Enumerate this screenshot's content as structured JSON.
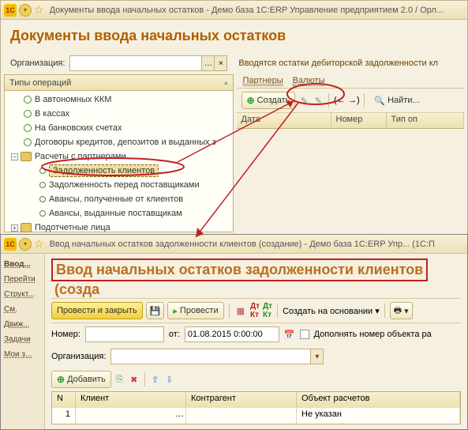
{
  "window1": {
    "title": "Документы ввода начальных остатков - Демо база 1С:ERP Управление предприятием 2.0 / Орл...",
    "page_title": "Документы ввода начальных остатков",
    "org_label": "Организация:",
    "filter_text": "Вводятся остатки дебиторской задолженности кл",
    "tree_header": "Типы операций",
    "tree": {
      "items": [
        "В автономных ККМ",
        "В кассах",
        "На банковских счетах",
        "Договоры кредитов, депозитов и выданных з"
      ],
      "group": "Расчеты с партнерами",
      "sub": [
        "Задолженность клиентов",
        "Задолженность перед поставщиками",
        "Авансы, полученные от клиентов",
        "Авансы, выданные поставщикам"
      ],
      "group2": "Подотчетные лица"
    },
    "tabs": {
      "partners": "Партнеры",
      "currencies": "Валюты"
    },
    "btn_create": "Создать",
    "btn_find": "Найти...",
    "cols": {
      "date": "Дата",
      "number": "Номер",
      "type": "Тип оп"
    }
  },
  "window2": {
    "title": "Ввод начальных остатков задолженности клиентов (создание) - Демо база 1С:ERP Упр...   (1С:П",
    "page_title": "Ввод начальных остатков задолженности клиентов",
    "page_title_suffix": "(созда",
    "sidebar": [
      "Ввод...",
      "Перейти",
      "Структ...",
      "См.",
      "Движ...",
      "Задачи",
      "Мои з..."
    ],
    "toolbar": {
      "post_close": "Провести и закрыть",
      "post": "Провести",
      "create_based": "Создать на основании"
    },
    "form": {
      "number_label": "Номер:",
      "from_label": "от:",
      "date_value": "01.08.2015 0:00:00",
      "fill_number": "Дополнять номер объекта ра",
      "org_label": "Организация:"
    },
    "add_btn": "Добавить",
    "grid": {
      "cols": {
        "n": "N",
        "client": "Клиент",
        "counterparty": "Контрагент",
        "object": "Объект расчетов"
      },
      "row1": {
        "n": "1",
        "object": "Не указан"
      }
    }
  }
}
